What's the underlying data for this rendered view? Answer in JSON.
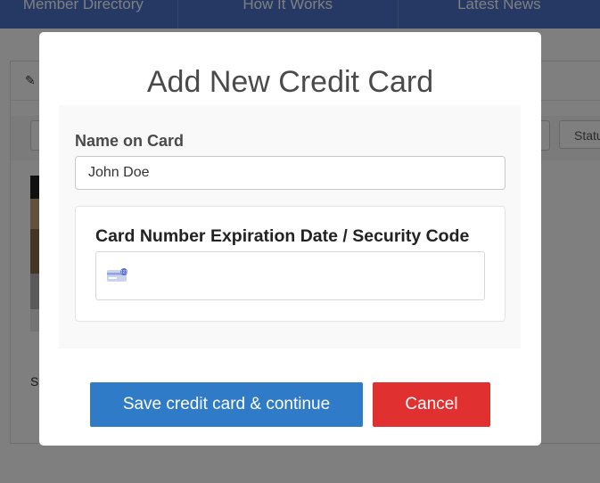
{
  "nav": {
    "items": [
      "Member Directory",
      "How It Works",
      "Latest News"
    ]
  },
  "background": {
    "status_filter_label": "Status",
    "sl_text": "Sl"
  },
  "modal": {
    "title": "Add New Credit Card",
    "name_label": "Name on Card",
    "name_value": "John Doe",
    "card_label": "Card Number Expiration Date / Security Code",
    "card_icon": "credit-card-icon",
    "save_label": "Save credit card & continue",
    "cancel_label": "Cancel"
  },
  "colors": {
    "nav_bg": "#4a72c9",
    "save_button": "#2f7bc8",
    "cancel_button": "#e03030"
  }
}
